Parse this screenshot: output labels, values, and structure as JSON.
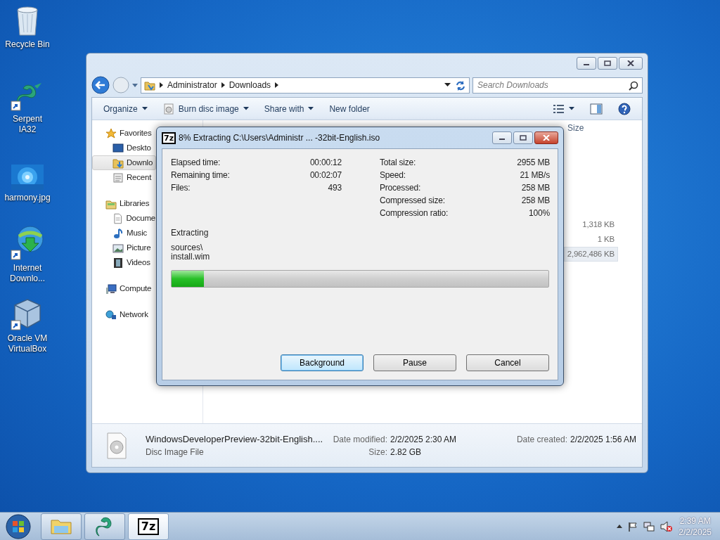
{
  "desktop_icons": [
    {
      "label": "Recycle Bin",
      "kind": "recycle"
    },
    {
      "label": "Serpent IA32",
      "kind": "serpent"
    },
    {
      "label": "harmony.jpg",
      "kind": "picture"
    },
    {
      "label": "Internet Downlo...",
      "kind": "download"
    },
    {
      "label": "Oracle VM VirtualBox",
      "kind": "virtualbox"
    }
  ],
  "explorer": {
    "address": {
      "path": [
        "Administrator",
        "Downloads"
      ]
    },
    "search": {
      "placeholder": "Search Downloads"
    },
    "toolbar": [
      {
        "label": "Organize",
        "dropdown": true,
        "kind": "plain"
      },
      {
        "label": "Burn disc image",
        "dropdown": true,
        "kind": "disc"
      },
      {
        "label": "Share with",
        "dropdown": true,
        "kind": "plain"
      },
      {
        "label": "New folder",
        "dropdown": false,
        "kind": "plain"
      }
    ],
    "nav": [
      {
        "label": "Favorites",
        "kind": "star",
        "selected": false,
        "children": [
          {
            "label": "Deskto",
            "kind": "desktop",
            "selected": false
          },
          {
            "label": "Downlo",
            "kind": "downloads",
            "selected": true
          },
          {
            "label": "Recent",
            "kind": "recent",
            "selected": false
          }
        ]
      },
      {
        "label": "Libraries",
        "kind": "library",
        "selected": false,
        "children": [
          {
            "label": "Docume",
            "kind": "document",
            "selected": false
          },
          {
            "label": "Music",
            "kind": "music",
            "selected": false
          },
          {
            "label": "Picture",
            "kind": "pictures",
            "selected": false
          },
          {
            "label": "Videos",
            "kind": "videos",
            "selected": false
          }
        ]
      },
      {
        "label": "Compute",
        "kind": "computer",
        "selected": false
      },
      {
        "label": "Network",
        "kind": "network",
        "selected": false
      }
    ],
    "columns": [
      "Size"
    ],
    "rows": [
      {
        "size": "1,318 KB",
        "selected": false
      },
      {
        "size": "1 KB",
        "selected": false
      },
      {
        "size": "2,962,486 KB",
        "selected": true
      }
    ],
    "details": {
      "name": "WindowsDeveloperPreview-32bit-English....",
      "type": "Disc Image File",
      "fields": [
        {
          "label": "Date modified:",
          "value": "2/2/2025 2:30 AM"
        },
        {
          "label": "Size:",
          "value": "2.82 GB"
        },
        {
          "label": "Date created:",
          "value": "2/2/2025 1:56 AM"
        }
      ]
    }
  },
  "dialog": {
    "icon_text": "7z",
    "title": "8% Extracting C:\\Users\\Administr ... -32bit-English.iso",
    "left_stats": [
      {
        "label": "Elapsed time:",
        "value": "00:00:12"
      },
      {
        "label": "Remaining time:",
        "value": "00:02:07"
      },
      {
        "label": "Files:",
        "value": "493"
      }
    ],
    "right_stats": [
      {
        "label": "Total size:",
        "value": "2955 MB"
      },
      {
        "label": "Speed:",
        "value": "21 MB/s"
      },
      {
        "label": "Processed:",
        "value": "258 MB"
      },
      {
        "label": "Compressed size:",
        "value": "258 MB"
      },
      {
        "label": "Compression ratio:",
        "value": "100%"
      }
    ],
    "status": "Extracting",
    "path_lines": [
      "sources\\",
      "install.wim"
    ],
    "progress": {
      "level": 0.085
    },
    "buttons": [
      {
        "label": "Background",
        "default": true
      },
      {
        "label": "Pause",
        "default": false
      },
      {
        "label": "Cancel",
        "default": false
      }
    ]
  },
  "taskbar": {
    "items": [
      {
        "kind": "explorer",
        "selected": false
      },
      {
        "kind": "serpent",
        "selected": false
      },
      {
        "kind": "sevenzip",
        "text": "7z",
        "selected": true
      }
    ],
    "time": "2:39 AM",
    "date": "2/2/2025"
  }
}
